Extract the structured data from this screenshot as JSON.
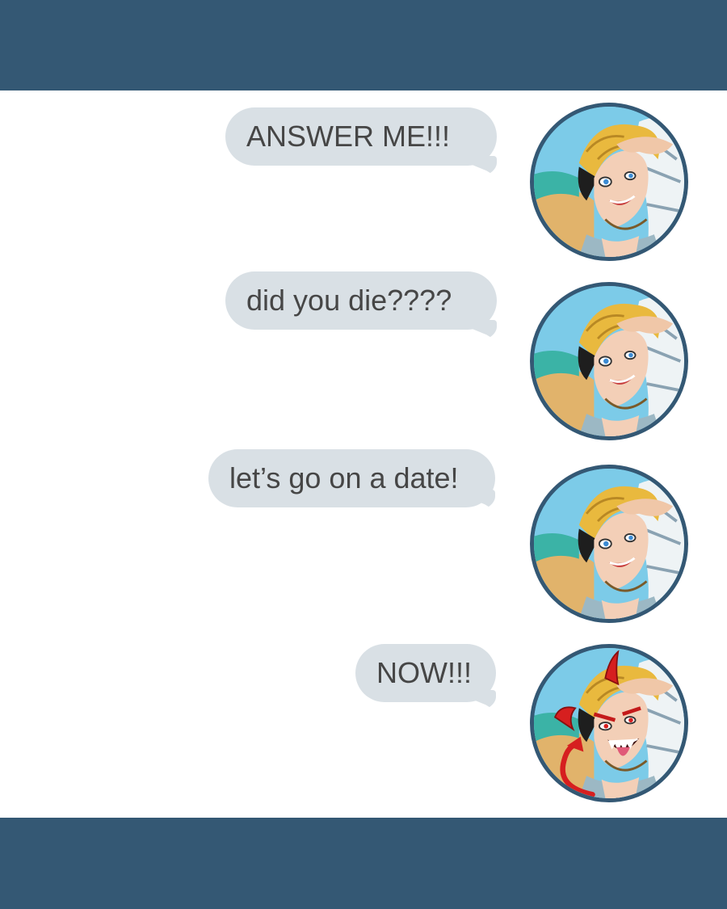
{
  "colors": {
    "bar": "#345874",
    "bubble": "#d9e0e5",
    "bubble_text": "#464646",
    "avatar_border": "#345874",
    "devil_red": "#d61f1f"
  },
  "messages": [
    {
      "text": "ANSWER ME!!!",
      "avatar": "character-avatar"
    },
    {
      "text": "did you die????",
      "avatar": "character-avatar"
    },
    {
      "text": "let’s go on a date!",
      "avatar": "character-avatar"
    },
    {
      "text": "NOW!!!",
      "avatar": "character-devil-avatar"
    }
  ]
}
